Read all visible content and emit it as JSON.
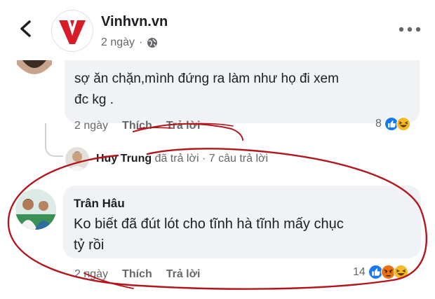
{
  "header": {
    "page_name": "Vinhvn.vn",
    "time": "2 ngày",
    "separator": "·"
  },
  "comment1": {
    "text_line1": "sợ ăn chặn,mình đứng ra làm như họ đi xem",
    "text_line2": "đc kg .",
    "time": "2 ngày",
    "like_label": "Thích",
    "reply_label": "Trả lời",
    "reaction_count": "8",
    "reaction_icons": [
      "like-reaction",
      "haha-reaction"
    ]
  },
  "reply_summary": {
    "name": "Huy Trung",
    "action": "đã trả lời",
    "separator": "·",
    "count_text": "7 câu trả lời"
  },
  "comment2": {
    "author": "Trân Hâu",
    "text_line1": "Ko biết đã đút lót cho tĩnh hà tĩnh mấy chục",
    "text_line2": "tỷ rồi",
    "time": "2 ngày",
    "like_label": "Thích",
    "reply_label": "Trả lời",
    "reaction_count": "14",
    "reaction_icons": [
      "like-reaction",
      "angry-reaction",
      "haha-reaction"
    ]
  },
  "colors": {
    "brand_red": "#d71e28",
    "like_blue": "#1877f2",
    "annotation_red": "#b3151d",
    "bubble_bg": "#f0f2f5",
    "meta_gray": "#65676b"
  }
}
